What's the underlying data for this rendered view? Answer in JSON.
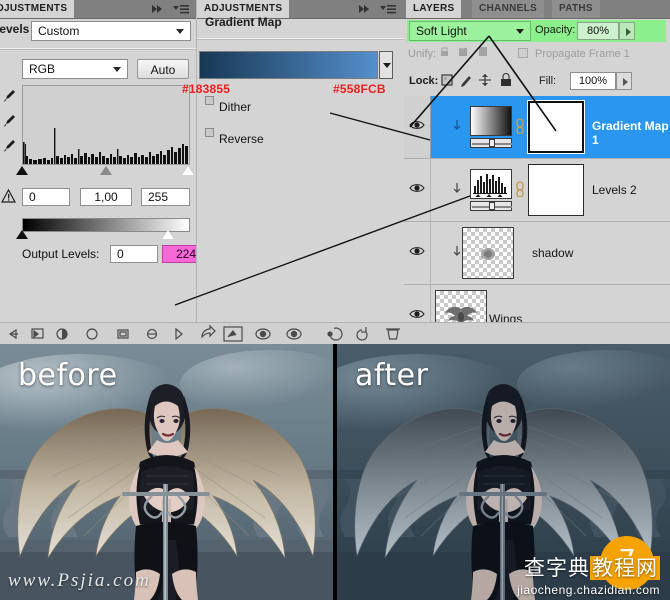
{
  "panels": {
    "adjustments_left": {
      "tab_label": "ADJUSTMENTS",
      "title": "Levels",
      "preset": "Custom",
      "channel": "RGB",
      "auto_label": "Auto",
      "input_shadow": "0",
      "input_midtone": "1,00",
      "input_highlight": "255",
      "output_label": "Output Levels:",
      "output_black": "0",
      "output_white": "224"
    },
    "adjustments_mid": {
      "tab_label": "ADJUSTMENTS",
      "title": "Gradient Map",
      "gradient_start_hex": "#183855",
      "gradient_end_hex": "#558FCB",
      "dither_label": "Dither",
      "reverse_label": "Reverse"
    },
    "layers": {
      "tabs": [
        "LAYERS",
        "CHANNELS",
        "PATHS"
      ],
      "active_tab": "LAYERS",
      "blend_mode": "Soft Light",
      "opacity_label": "Opacity:",
      "opacity_value": "80%",
      "unify_label": "Unify:",
      "propagate_label": "Propagate Frame 1",
      "lock_label": "Lock:",
      "fill_label": "Fill:",
      "fill_value": "100%",
      "highlight_color": "#8bf08b",
      "selection_color": "#2a96f0",
      "rows": [
        {
          "name": "Gradient Map 1",
          "selected": true,
          "thumb": "gradient-map",
          "has_mask": true,
          "clipped": true,
          "underline": false
        },
        {
          "name": "Levels 2",
          "selected": false,
          "thumb": "levels",
          "has_mask": true,
          "clipped": true,
          "underline": false
        },
        {
          "name": "shadow",
          "selected": false,
          "thumb": "transparent",
          "has_mask": false,
          "clipped": true,
          "underline": false
        },
        {
          "name": "Wings",
          "selected": false,
          "thumb": "transparent",
          "has_mask": false,
          "clipped": false,
          "underline": true
        }
      ]
    }
  },
  "comparison": {
    "before_label": "before",
    "after_label": "after",
    "before_watermark": "www.Psjia.com",
    "after_watermark_badge": "7",
    "after_watermark_cn_1": "查字典",
    "after_watermark_cn_2": "教程网",
    "after_watermark_url": "jiaocheng.chazidian.com"
  }
}
